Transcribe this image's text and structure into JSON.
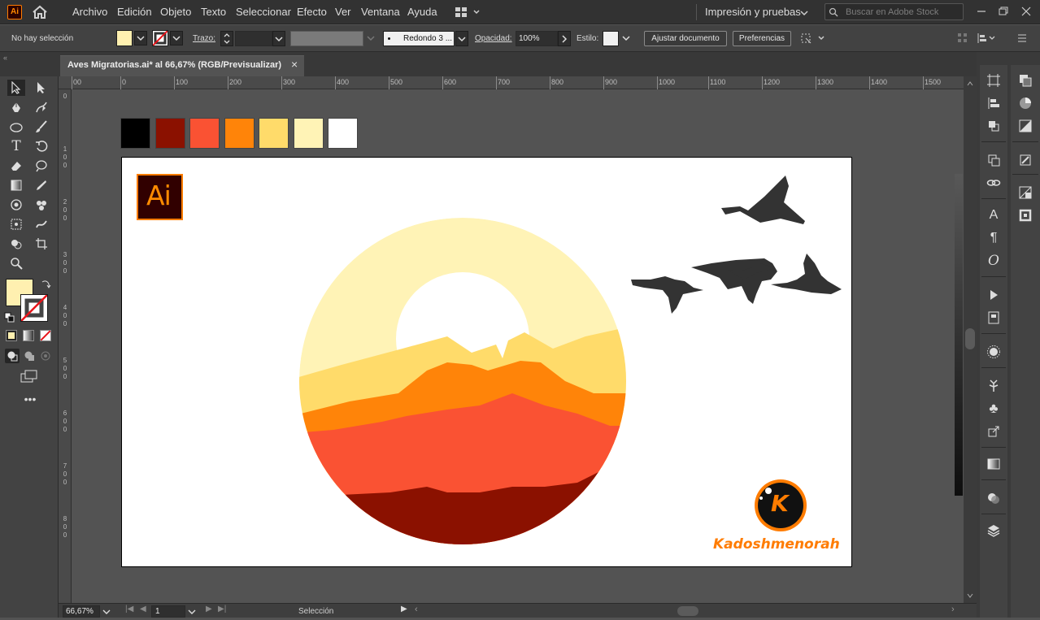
{
  "app": {
    "logo": "Ai"
  },
  "menu": {
    "items": [
      "Archivo",
      "Edición",
      "Objeto",
      "Texto",
      "Seleccionar",
      "Efecto",
      "Ver",
      "Ventana",
      "Ayuda"
    ],
    "workspace": "Impresión y pruebas",
    "search_placeholder": "Buscar en Adobe Stock"
  },
  "control": {
    "selection_status": "No hay selección",
    "stroke_label": "Trazo:",
    "brush_label": "Redondo 3 ...",
    "opacity_label": "Opacidad:",
    "opacity_value": "100%",
    "style_label": "Estilo:",
    "adjust_button": "Ajustar documento",
    "prefs_button": "Preferencias"
  },
  "document": {
    "tab_title": "Aves Migratorias.ai* al 66,67% (RGB/Previsualizar)",
    "close_glyph": "×"
  },
  "ruler": {
    "top": [
      "00",
      "0",
      "100",
      "200",
      "300",
      "400",
      "500",
      "600",
      "700",
      "800",
      "900",
      "1000",
      "1100",
      "1200",
      "1300",
      "1400",
      "1500"
    ],
    "left": [
      "0",
      "100",
      "200",
      "300",
      "400",
      "500",
      "600",
      "700",
      "800"
    ]
  },
  "status": {
    "zoom": "66,67%",
    "artboard_number": "1",
    "mode": "Selección"
  },
  "artwork": {
    "badge_text": "Ai",
    "watermark_letter": "K",
    "watermark_name": "Kadoshmenorah"
  },
  "colors": {
    "swatches": [
      "#000000",
      "#8b1100",
      "#fa5233",
      "#ff8409",
      "#ffdb6a",
      "#fff3b6",
      "#ffffff"
    ],
    "fill": "#fff0b0",
    "ai_brand": "#ff7c00",
    "ai_bg": "#310000"
  },
  "icons": {
    "home": "home-icon",
    "search": "search-icon",
    "minimize": "minimize-icon",
    "restore": "restore-icon",
    "close": "close-icon"
  }
}
